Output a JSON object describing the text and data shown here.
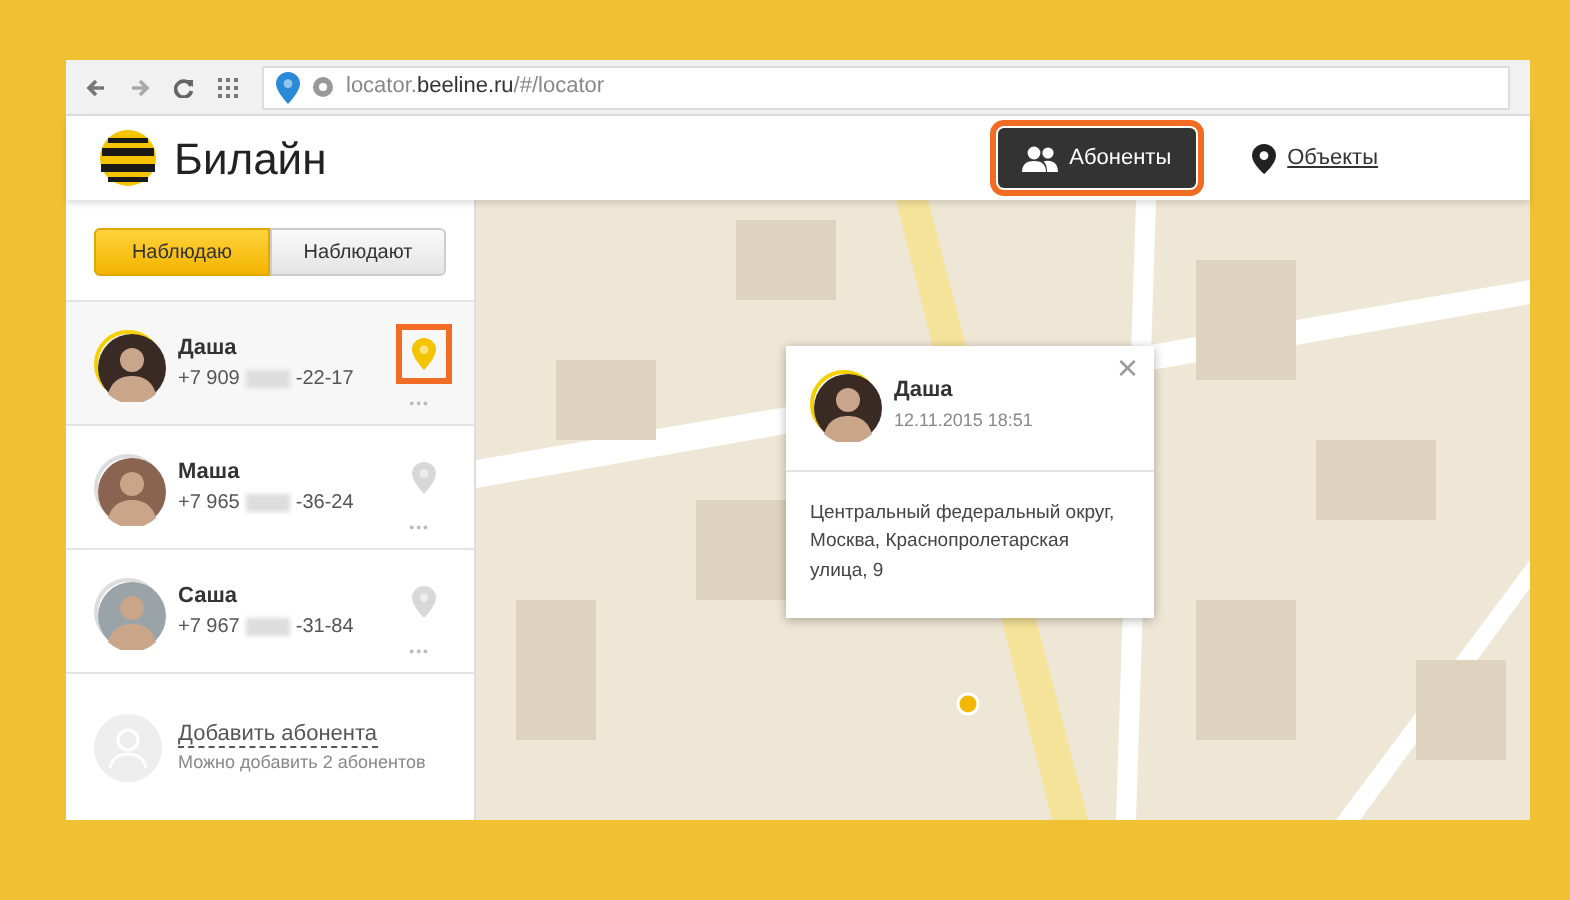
{
  "browser": {
    "url_host": "locator.",
    "url_domain": "beeline.ru",
    "url_path": "/#/locator"
  },
  "header": {
    "logo_text": "Билайн",
    "nav": [
      {
        "label": "Абоненты",
        "selected": true,
        "highlighted": true
      },
      {
        "label": "Объекты",
        "selected": false,
        "highlighted": false
      }
    ]
  },
  "tabs": [
    {
      "label": "Наблюдаю",
      "selected": true
    },
    {
      "label": "Наблюдают",
      "selected": false
    }
  ],
  "contacts": [
    {
      "name": "Даша",
      "phone_start": "+7 909",
      "phone_end": "-22-17",
      "selected": true,
      "pin_highlighted": true,
      "more": "•••"
    },
    {
      "name": "Маша",
      "phone_start": "+7 965",
      "phone_end": "-36-24",
      "selected": false,
      "pin_highlighted": false,
      "more": "•••"
    },
    {
      "name": "Саша",
      "phone_start": "+7 967",
      "phone_end": "-31-84",
      "selected": false,
      "pin_highlighted": false,
      "more": "•••"
    }
  ],
  "add_contact": {
    "label": "Добавить абонента",
    "hint": "Можно добавить 2 абонентов"
  },
  "popup": {
    "name": "Даша",
    "time": "12.11.2015 18:51",
    "address": "Центральный федеральный округ, Москва, Краснопролетарская улица, 9",
    "close": "×"
  }
}
